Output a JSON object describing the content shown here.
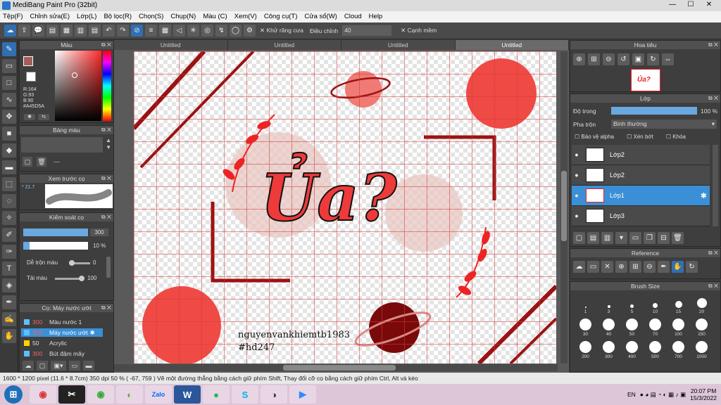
{
  "window": {
    "title": "MediBang Paint Pro (32bit)",
    "minimize": "—",
    "maximize": "☐",
    "close": "✕"
  },
  "menu": [
    "Tệp(F)",
    "Chỉnh sửa(E)",
    "Lớp(L)",
    "Bộ lọc(R)",
    "Chọn(S)",
    "Chụp(N)",
    "Màu (C)",
    "Xem(V)",
    "Công cụ(T)",
    "Cửa sổ(W)",
    "Cloud",
    "Help"
  ],
  "toolbar": {
    "antialias_label": "Khử răng cưa",
    "adjust_label": "Điều chỉnh",
    "adjust_value": "40",
    "snap_label": "Cạnh mềm"
  },
  "color_panel": {
    "title": "Màu",
    "r": "R:164",
    "g": "G:93",
    "b": "B:90",
    "hex": "#A45D5A",
    "primary_color": "#A45D5A"
  },
  "palette_panel": {
    "title": "Bảng màu",
    "dash": "---"
  },
  "brush_preview": {
    "title": "Xem trước cọ",
    "size": "21.7"
  },
  "brush_control": {
    "title": "Kiểm soát cọ",
    "size_value": "300",
    "opacity_value": "10 %",
    "blend_label": "Dễ trộn màu",
    "blend_value": "0",
    "amount_label": "Tải màu",
    "amount_value": "100"
  },
  "brush_list": {
    "title": "Cọ: Máy nước ướt",
    "items": [
      {
        "size": "300",
        "name": "Màu nước 1"
      },
      {
        "size": "300",
        "name": "Máy nước ướt"
      },
      {
        "size": "50",
        "name": "Acrylic"
      },
      {
        "size": "300",
        "name": "Bút đậm mây"
      }
    ]
  },
  "tabs": [
    "Untitled",
    "Untitled",
    "Untitled",
    "Untitled"
  ],
  "artwork": {
    "title_text": "Ủa?",
    "signature": "nguyenvankhiemtb1983",
    "hashtag": "#hd247"
  },
  "navigator": {
    "title": "Hoa tiêu"
  },
  "layers": {
    "title": "Lớp",
    "opacity_label": "Độ trong",
    "opacity_value": "100 %",
    "blend_label": "Pha trộn",
    "blend_value": "Bình thường",
    "protect_alpha": "Bảo vệ alpha",
    "clipping": "Xén bớt",
    "lock": "Khóa",
    "items": [
      {
        "name": "Lớp2"
      },
      {
        "name": "Lớp2"
      },
      {
        "name": "Lớp1"
      },
      {
        "name": "Lớp3"
      }
    ]
  },
  "reference": {
    "title": "Reference"
  },
  "brush_size": {
    "title": "Brush Size",
    "sizes": [
      "1",
      "3",
      "5",
      "10",
      "15",
      "20",
      "30",
      "40",
      "50",
      "70",
      "100",
      "150",
      "200",
      "300",
      "400",
      "500",
      "700",
      "1000"
    ]
  },
  "status": {
    "text": "1600 * 1200 pixel  (11.6 * 8.7cm)  350 dpi  50 %  ( -67, 759 )  Vẽ một đường thẳng bằng cách giữ phím Shift, Thay đổi cỡ cọ bằng cách giữ phím Ctrl, Alt và kéo"
  },
  "taskbar": {
    "lang": "EN",
    "time": "20:07 PM",
    "date": "15/3/2022"
  }
}
